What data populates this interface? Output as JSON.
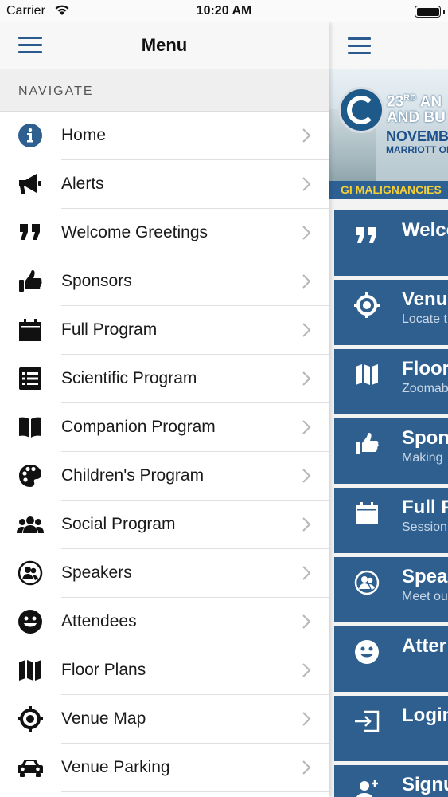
{
  "status_bar": {
    "carrier": "Carrier",
    "time": "10:20 AM"
  },
  "drawer": {
    "title": "Menu",
    "section": "NAVIGATE",
    "items": [
      {
        "label": "Home",
        "icon": "info-icon"
      },
      {
        "label": "Alerts",
        "icon": "megaphone-icon"
      },
      {
        "label": "Welcome Greetings",
        "icon": "quote-icon"
      },
      {
        "label": "Sponsors",
        "icon": "thumbs-up-icon"
      },
      {
        "label": "Full Program",
        "icon": "calendar-icon"
      },
      {
        "label": "Scientific Program",
        "icon": "list-icon"
      },
      {
        "label": "Companion Program",
        "icon": "book-icon"
      },
      {
        "label": "Children's Program",
        "icon": "palette-icon"
      },
      {
        "label": "Social Program",
        "icon": "group-icon"
      },
      {
        "label": "Speakers",
        "icon": "speakers-icon"
      },
      {
        "label": "Attendees",
        "icon": "smiley-icon"
      },
      {
        "label": "Floor Plans",
        "icon": "map-icon"
      },
      {
        "label": "Venue Map",
        "icon": "crosshairs-icon"
      },
      {
        "label": "Venue Parking",
        "icon": "car-icon"
      }
    ]
  },
  "main": {
    "banner": {
      "title_line1_prefix": "23",
      "title_line1_sup": "RD",
      "title_line1_rest": " AN",
      "title_line2": "AND BU",
      "date": "NOVEMB",
      "venue": "MARRIOTT ON",
      "strip": "GI MALIGNANCIES"
    },
    "tiles": [
      {
        "title": "Welco",
        "subtitle": "",
        "icon": "quote-icon"
      },
      {
        "title": "Venu",
        "subtitle": "Locate t",
        "icon": "crosshairs-icon"
      },
      {
        "title": "Floor",
        "subtitle": "Zoomab",
        "icon": "map-icon"
      },
      {
        "title": "Spon",
        "subtitle": "Making",
        "icon": "thumbs-up-icon"
      },
      {
        "title": "Full P",
        "subtitle": "Session",
        "icon": "calendar-icon"
      },
      {
        "title": "Spea",
        "subtitle": "Meet ou",
        "icon": "speakers-icon"
      },
      {
        "title": "Atter",
        "subtitle": "",
        "icon": "smiley-icon"
      },
      {
        "title": "Login",
        "subtitle": "",
        "icon": "login-icon"
      },
      {
        "title": "Signu",
        "subtitle": "",
        "icon": "signup-icon"
      }
    ]
  },
  "colors": {
    "accent": "#2e5f8f",
    "hamburger": "#2a5a8e",
    "banner_strip_text": "#f4cf36"
  }
}
